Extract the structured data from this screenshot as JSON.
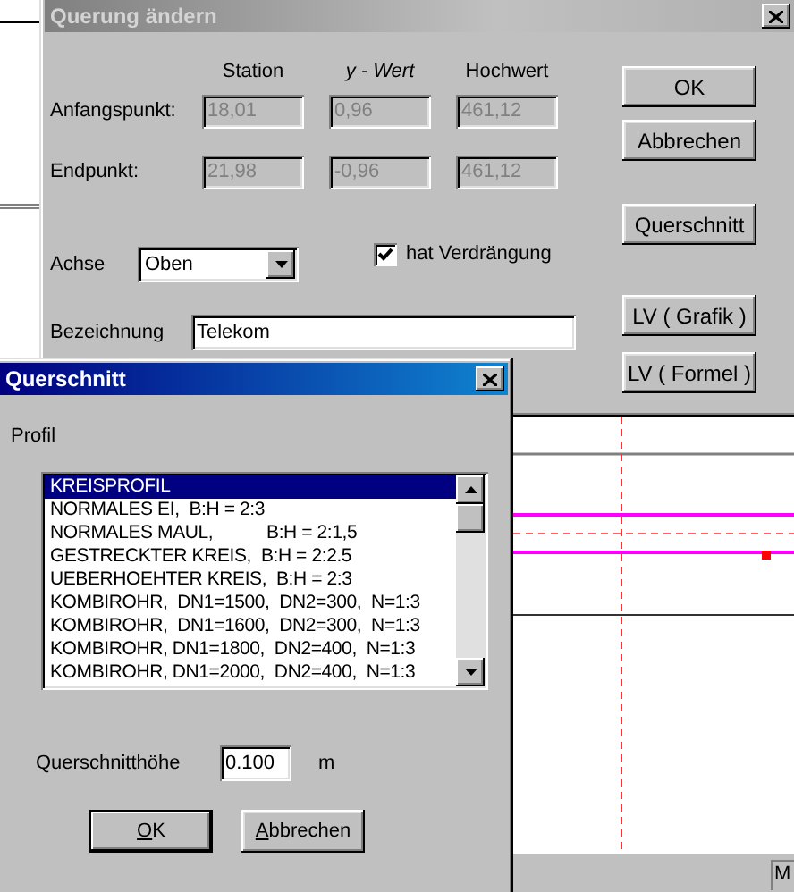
{
  "app": {
    "status_text": "M"
  },
  "querung_dialog": {
    "title": "Querung ändern",
    "active": false,
    "columns": [
      "Station",
      "y - Wert",
      "Hochwert"
    ],
    "points": [
      {
        "label": "Anfangspunkt:",
        "values": [
          {
            "value": "18,01",
            "disabled": true
          },
          {
            "value": "0,96",
            "disabled": true
          },
          {
            "value": "461,12",
            "disabled": true
          }
        ]
      },
      {
        "label": "Endpunkt:",
        "values": [
          {
            "value": "21,98",
            "disabled": true
          },
          {
            "value": "-0,96",
            "disabled": true
          },
          {
            "value": "461,12",
            "disabled": true
          }
        ]
      }
    ],
    "achse": {
      "label": "Achse",
      "value": "Oben"
    },
    "verdraengung": {
      "label": "hat Verdrängung",
      "checked": true
    },
    "bezeichnung": {
      "label": "Bezeichnung",
      "value": "Telekom"
    },
    "buttons": [
      {
        "label": "OK"
      },
      {
        "label": "Abbrechen"
      },
      {
        "label": "Querschnitt"
      },
      {
        "label": "LV ( Grafik )"
      },
      {
        "label": "LV ( Formel )"
      }
    ]
  },
  "querschnitt_dialog": {
    "title": "Querschnitt",
    "active": true,
    "profil": {
      "label": "Profil",
      "items": [
        {
          "label": "KREISPROFIL",
          "selected": true
        },
        {
          "label": "NORMALES EI,  B:H = 2:3",
          "selected": false
        },
        {
          "label": "NORMALES MAUL,           B:H = 2:1,5",
          "selected": false
        },
        {
          "label": "GESTRECKTER KREIS,  B:H = 2:2.5",
          "selected": false
        },
        {
          "label": "UEBERHOEHTER KREIS,  B:H = 2:3",
          "selected": false
        },
        {
          "label": "KOMBIROHR,  DN1=1500,  DN2=300,  N=1:3",
          "selected": false
        },
        {
          "label": "KOMBIROHR,  DN1=1600,  DN2=300,  N=1:3",
          "selected": false
        },
        {
          "label": "KOMBIROHR, DN1=1800,  DN2=400,  N=1:3",
          "selected": false
        },
        {
          "label": "KOMBIROHR, DN1=2000,  DN2=400,  N=1:3",
          "selected": false
        }
      ]
    },
    "hoehe": {
      "label": "Querschnitthöhe",
      "value": "0.100",
      "unit": "m"
    },
    "buttons": [
      {
        "label": "OK",
        "mnemonic": true,
        "default": true
      },
      {
        "label": "Abbrechen",
        "mnemonic": true,
        "default": false
      }
    ]
  }
}
